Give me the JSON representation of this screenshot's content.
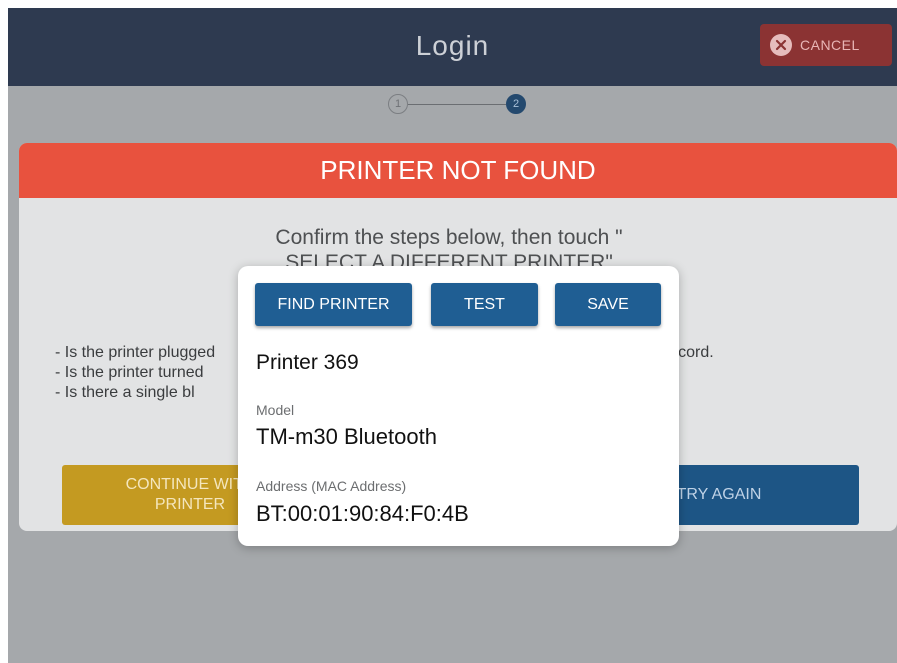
{
  "header": {
    "title": "Login",
    "cancel_label": "CANCEL",
    "cancel_icon": "close-circle-icon"
  },
  "stepper": {
    "steps": [
      "1",
      "2"
    ],
    "current": 2
  },
  "dialog": {
    "title": "PRINTER NOT FOUND",
    "message_line1": "Confirm the steps below, then touch \"",
    "message_line2": "SELECT A DIFFERENT PRINTER\"",
    "checklist": [
      "- Is the printer plugged",
      "- Is the printer turned",
      "- Is there a single bl"
    ],
    "checklist_tail": "ter cord.",
    "continue_line1": "CONTINUE WITH",
    "continue_line2": "PRINTER",
    "try_again_label": "TRY AGAIN"
  },
  "printer_popup": {
    "find_label": "FIND PRINTER",
    "test_label": "TEST",
    "save_label": "SAVE",
    "printer_name": "Printer 369",
    "model_label": "Model",
    "model_value": "TM-m30 Bluetooth",
    "address_label": "Address (MAC Address)",
    "address_value": "BT:00:01:90:84:F0:4B"
  },
  "colors": {
    "topbar": "#2e3a50",
    "dialog_header": "#e8523e",
    "primary_button": "#1f5e93",
    "continue_button": "#c49a21",
    "cancel_button": "#8b3333"
  }
}
